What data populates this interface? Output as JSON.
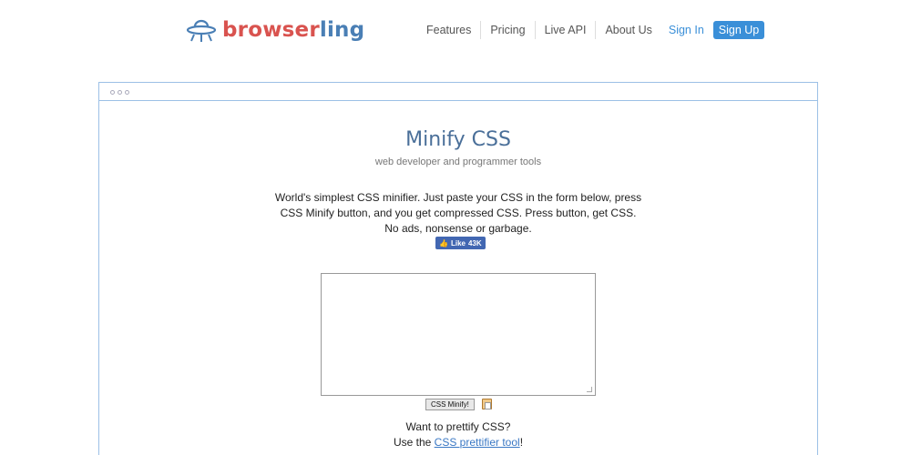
{
  "header": {
    "logo": {
      "text_a": "browser",
      "text_b": "ling",
      "icon": "ufo-icon"
    },
    "nav": [
      "Features",
      "Pricing",
      "Live API",
      "About Us"
    ],
    "sign_in": "Sign In",
    "sign_up": "Sign Up"
  },
  "main": {
    "title": "Minify CSS",
    "subtitle": "web developer and programmer tools",
    "description": "World's simplest CSS minifier. Just paste your CSS in the form below, press CSS Minify button, and you get compressed CSS. Press button, get CSS. No ads, nonsense or garbage.",
    "fb_like": {
      "label": "Like",
      "count": "43K",
      "icon": "thumbs-up-icon"
    },
    "textarea_value": "",
    "minify_button": "CSS Minify!",
    "clipboard_icon": "clipboard-icon",
    "prettify_question": "Want to prettify CSS?",
    "prettify_prefix": "Use the ",
    "prettify_link": "CSS prettifier tool",
    "prettify_suffix": "!"
  },
  "colors": {
    "brand_red": "#d9534f",
    "brand_blue": "#4a7fb5",
    "accent": "#3a8fd8",
    "frame_border": "#9cc0e6",
    "facebook": "#4267b2"
  }
}
